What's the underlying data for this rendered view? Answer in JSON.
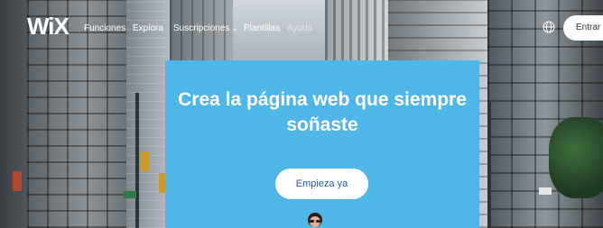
{
  "nav": {
    "logo": "WiX",
    "links": [
      {
        "label": "Funciones"
      },
      {
        "label": "Explora"
      },
      {
        "label": "Suscripciones"
      },
      {
        "label": "Plantillas"
      },
      {
        "label": "Ayuda"
      }
    ],
    "language_icon": "globe-icon",
    "login_label": "Entrar"
  },
  "hero": {
    "title_line1": "Crea la página web que siempre",
    "title_line2": "soñaste",
    "cta_label": "Empieza ya",
    "accent_color": "#4fb6e8"
  }
}
